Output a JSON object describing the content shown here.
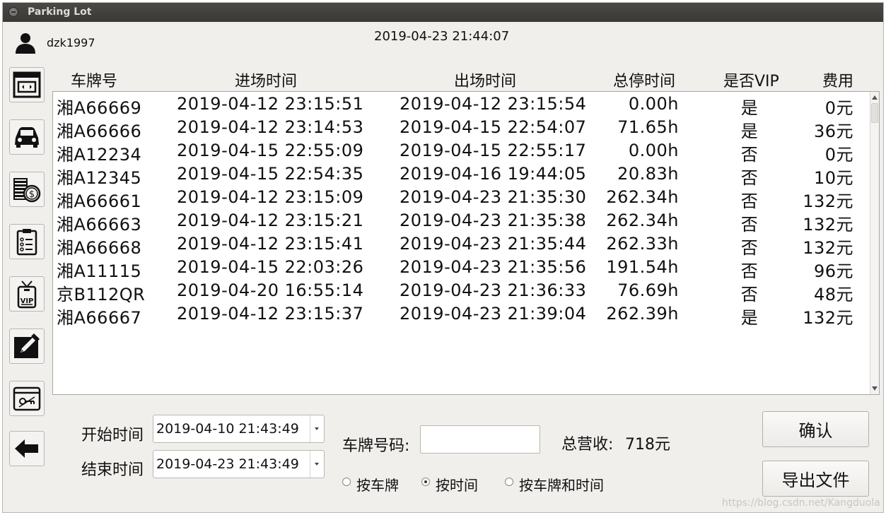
{
  "window": {
    "title": "Parking Lot"
  },
  "user": {
    "name": "dzk1997"
  },
  "datetime": "2019-04-23 21:44:07",
  "sidebar": [
    {
      "name": "dashboard-icon"
    },
    {
      "name": "car-icon"
    },
    {
      "name": "coins-icon"
    },
    {
      "name": "clipboard-icon"
    },
    {
      "name": "vip-badge-icon"
    },
    {
      "name": "edit-icon"
    },
    {
      "name": "settings-key-icon"
    },
    {
      "name": "back-arrow-icon"
    }
  ],
  "table": {
    "headers": [
      "车牌号",
      "进场时间",
      "出场时间",
      "总停时间",
      "是否VIP",
      "费用"
    ],
    "rows": [
      [
        "湘A66669",
        "2019-04-12 23:15:51",
        "2019-04-12 23:15:54",
        "0.00h",
        "是",
        "0元"
      ],
      [
        "湘A66666",
        "2019-04-12 23:14:53",
        "2019-04-15 22:54:07",
        "71.65h",
        "是",
        "36元"
      ],
      [
        "湘A12234",
        "2019-04-15 22:55:09",
        "2019-04-15 22:55:17",
        "0.00h",
        "否",
        "0元"
      ],
      [
        "湘A12345",
        "2019-04-15 22:54:35",
        "2019-04-16 19:44:05",
        "20.83h",
        "否",
        "10元"
      ],
      [
        "湘A66661",
        "2019-04-12 23:15:09",
        "2019-04-23 21:35:30",
        "262.34h",
        "否",
        "132元"
      ],
      [
        "湘A66663",
        "2019-04-12 23:15:21",
        "2019-04-23 21:35:38",
        "262.34h",
        "否",
        "132元"
      ],
      [
        "湘A66668",
        "2019-04-12 23:15:41",
        "2019-04-23 21:35:44",
        "262.33h",
        "否",
        "132元"
      ],
      [
        "湘A11115",
        "2019-04-15 22:03:26",
        "2019-04-23 21:35:56",
        "191.54h",
        "否",
        "96元"
      ],
      [
        "京B112QR",
        "2019-04-20 16:55:14",
        "2019-04-23 21:36:33",
        "76.69h",
        "否",
        "48元"
      ],
      [
        "湘A66667",
        "2019-04-12 23:15:37",
        "2019-04-23 21:39:04",
        "262.39h",
        "是",
        "132元"
      ]
    ]
  },
  "filters": {
    "start_label": "开始时间",
    "start_value": "2019-04-10 21:43:49",
    "end_label": "结束时间",
    "end_value": "2019-04-23 21:43:49",
    "plate_label": "车牌号码:",
    "plate_value": "",
    "revenue_label": "总营收:",
    "revenue_value": "718元",
    "radios": [
      {
        "label": "按车牌",
        "checked": false
      },
      {
        "label": "按时间",
        "checked": true
      },
      {
        "label": "按车牌和时间",
        "checked": false
      }
    ]
  },
  "buttons": {
    "confirm": "确认",
    "export": "导出文件"
  },
  "watermark": "https://blog.csdn.net/Kangduola"
}
